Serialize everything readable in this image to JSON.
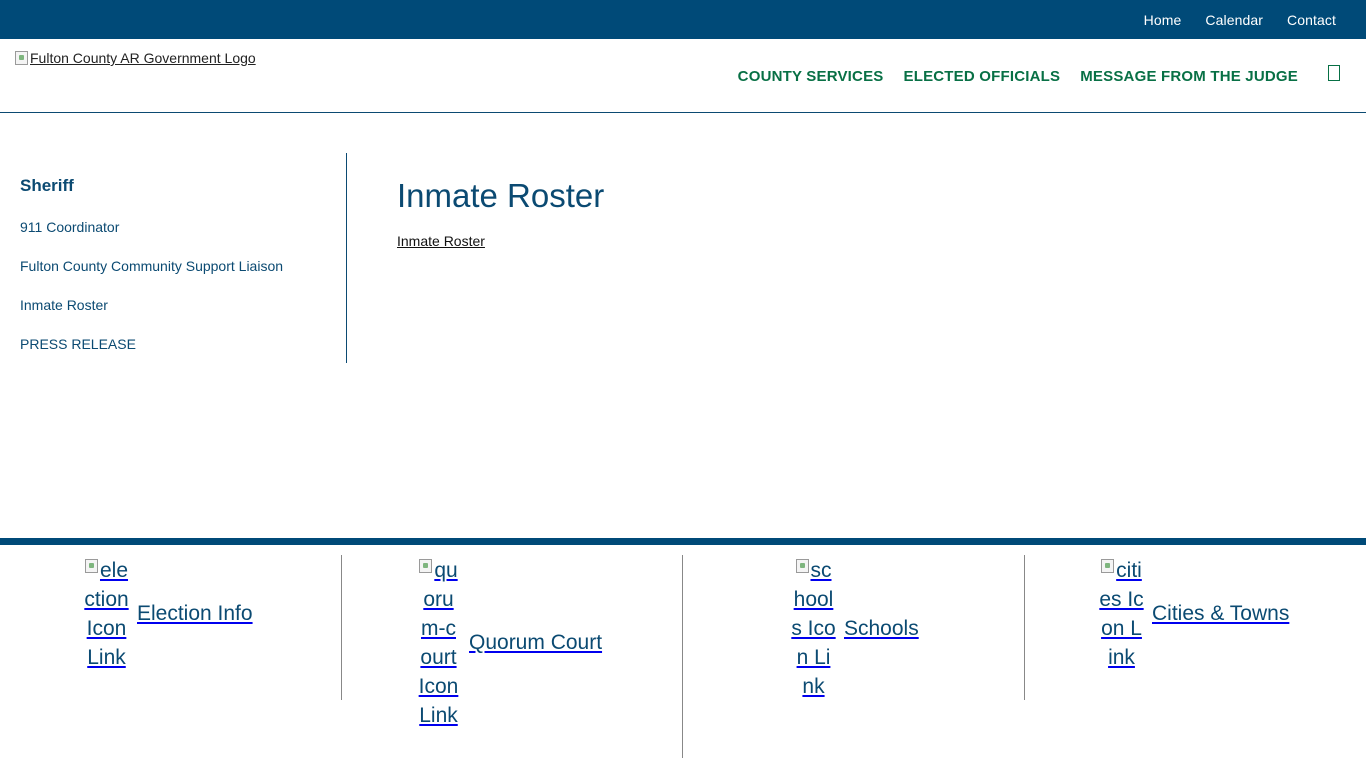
{
  "topnav": {
    "items": [
      "Home",
      "Calendar",
      "Contact"
    ]
  },
  "header": {
    "logo_alt": "Fulton County AR Government Logo",
    "nav": [
      "COUNTY SERVICES",
      "ELECTED OFFICIALS",
      "MESSAGE FROM THE JUDGE"
    ],
    "menu_icon": "menu-icon"
  },
  "sidebar": {
    "title": "Sheriff",
    "items": [
      "911 Coordinator",
      "Fulton County Community Support Liaison",
      "Inmate Roster",
      "PRESS RELEASE"
    ]
  },
  "main": {
    "title": "Inmate Roster",
    "link": "Inmate Roster"
  },
  "footer": {
    "items": [
      {
        "alt": "election Icon Link",
        "label": "Election Info"
      },
      {
        "alt": "quorum-court Icon Link",
        "label": "Quorum Court"
      },
      {
        "alt": "schools Icon Link",
        "label": "Schools"
      },
      {
        "alt": "cities Icon Link",
        "label": "Cities & Towns"
      }
    ]
  },
  "colors": {
    "brand_blue": "#004a78",
    "nav_green": "#087045",
    "text_blue": "#0b4a72"
  }
}
